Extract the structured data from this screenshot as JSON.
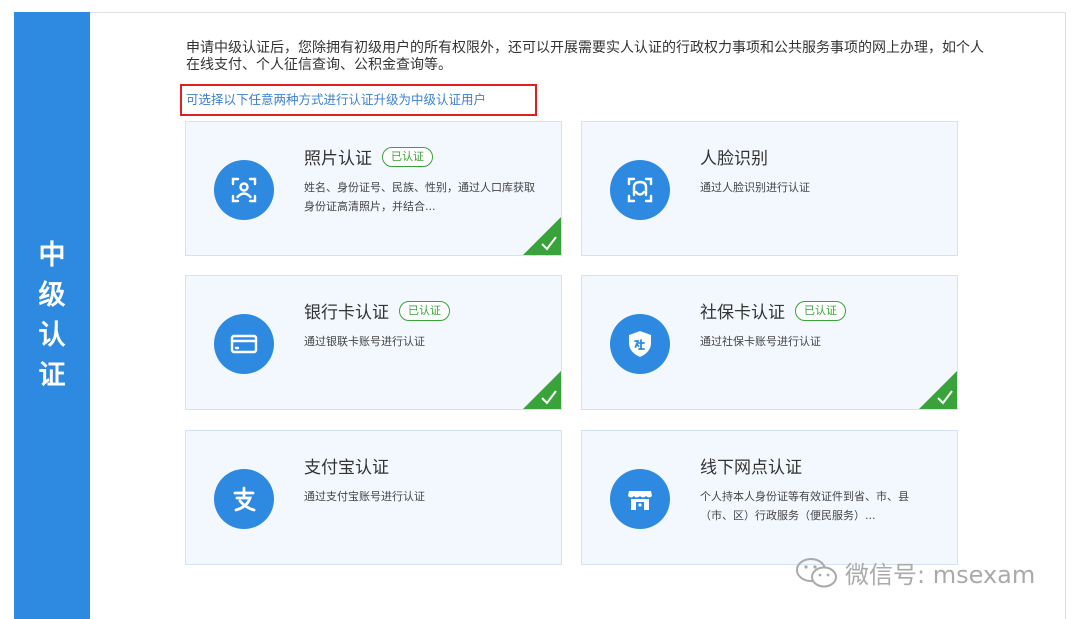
{
  "sidebar": {
    "title_chars": [
      "中",
      "级",
      "认",
      "证"
    ]
  },
  "intro_text": "申请中级认证后，您除拥有初级用户的所有权限外，还可以开展需要实人认证的行政权力事项和公共服务事项的网上办理，如个人在线支付、个人征信查询、公积金查询等。",
  "hint_text": "可选择以下任意两种方式进行认证升级为中级认证用户",
  "cards": [
    {
      "title": "照片认证",
      "badge": "已认证",
      "verified": true,
      "icon": "id-photo-icon",
      "desc": "姓名、身份证号、民族、性别，通过人口库获取身份证高清照片，并结合..."
    },
    {
      "title": "人脸识别",
      "badge": "",
      "verified": false,
      "icon": "face-scan-icon",
      "desc": "通过人脸识别进行认证"
    },
    {
      "title": "银行卡认证",
      "badge": "已认证",
      "verified": true,
      "icon": "bank-card-icon",
      "desc": "通过银联卡账号进行认证"
    },
    {
      "title": "社保卡认证",
      "badge": "已认证",
      "verified": true,
      "icon": "social-security-shield-icon",
      "desc": "通过社保卡账号进行认证"
    },
    {
      "title": "支付宝认证",
      "badge": "",
      "verified": false,
      "icon": "alipay-icon",
      "desc": "通过支付宝账号进行认证"
    },
    {
      "title": "线下网点认证",
      "badge": "",
      "verified": false,
      "icon": "service-outlet-icon",
      "desc": "个人持本人身份证等有效证件到省、市、县（市、区）行政服务（便民服务）..."
    }
  ],
  "watermark": {
    "text": "微信号: msexam",
    "icon": "wechat-icon"
  },
  "colors": {
    "accent": "#2e8ae0",
    "verified": "#3aa23a",
    "hint": "#3b7fd6",
    "highlight_border": "#e02020",
    "card_bg": "#f3f8fe"
  }
}
